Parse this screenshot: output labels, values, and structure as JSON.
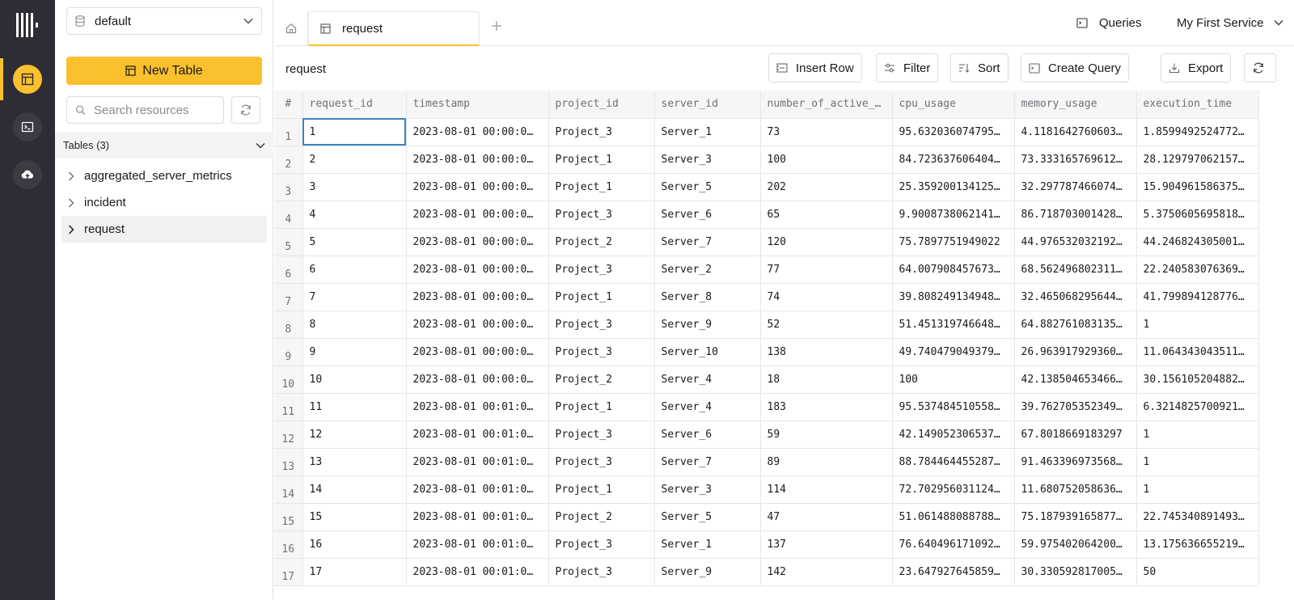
{
  "sidebar": {
    "database": "default",
    "new_table_label": "New Table",
    "search_placeholder": "Search resources",
    "tables_header": "Tables (3)",
    "tables": [
      {
        "name": "aggregated_server_metrics",
        "selected": false
      },
      {
        "name": "incident",
        "selected": false
      },
      {
        "name": "request",
        "selected": true
      }
    ]
  },
  "tabs": {
    "active_label": "request"
  },
  "header": {
    "queries_label": "Queries",
    "service_label": "My First Service"
  },
  "toolbar": {
    "table_title": "request",
    "insert_row_label": "Insert Row",
    "filter_label": "Filter",
    "sort_label": "Sort",
    "create_query_label": "Create Query",
    "export_label": "Export"
  },
  "grid": {
    "row_number_header": "#",
    "columns": [
      "request_id",
      "timestamp",
      "project_id",
      "server_id",
      "number_of_active_…",
      "cpu_usage",
      "memory_usage",
      "execution_time"
    ],
    "rows": [
      [
        "1",
        "2023-08-01 00:00:0…",
        "Project_3",
        "Server_1",
        "73",
        "95.632036074795…",
        "4.1181642760603…",
        "1.8599492524772…"
      ],
      [
        "2",
        "2023-08-01 00:00:0…",
        "Project_1",
        "Server_3",
        "100",
        "84.723637606404…",
        "73.333165769612…",
        "28.129797062157…"
      ],
      [
        "3",
        "2023-08-01 00:00:0…",
        "Project_1",
        "Server_5",
        "202",
        "25.359200134125…",
        "32.297787466074…",
        "15.904961586375…"
      ],
      [
        "4",
        "2023-08-01 00:00:0…",
        "Project_3",
        "Server_6",
        "65",
        "9.9008738062141…",
        "86.718703001428…",
        "5.3750605695818…"
      ],
      [
        "5",
        "2023-08-01 00:00:0…",
        "Project_2",
        "Server_7",
        "120",
        "75.7897751949022",
        "44.976532032192…",
        "44.246824305001…"
      ],
      [
        "6",
        "2023-08-01 00:00:0…",
        "Project_3",
        "Server_2",
        "77",
        "64.007908457673…",
        "68.562496802311…",
        "22.240583076369…"
      ],
      [
        "7",
        "2023-08-01 00:00:0…",
        "Project_1",
        "Server_8",
        "74",
        "39.808249134948…",
        "32.465068295644…",
        "41.799894128776…"
      ],
      [
        "8",
        "2023-08-01 00:00:0…",
        "Project_3",
        "Server_9",
        "52",
        "51.451319746648…",
        "64.882761083135…",
        "1"
      ],
      [
        "9",
        "2023-08-01 00:00:0…",
        "Project_3",
        "Server_10",
        "138",
        "49.740479049379…",
        "26.963917929360…",
        "11.064343043511…"
      ],
      [
        "10",
        "2023-08-01 00:00:0…",
        "Project_2",
        "Server_4",
        "18",
        "100",
        "42.138504653466…",
        "30.156105204882…"
      ],
      [
        "11",
        "2023-08-01 00:01:0…",
        "Project_1",
        "Server_4",
        "183",
        "95.537484510558…",
        "39.762705352349…",
        "6.3214825700921…"
      ],
      [
        "12",
        "2023-08-01 00:01:0…",
        "Project_3",
        "Server_6",
        "59",
        "42.149052306537…",
        "67.8018669183297",
        "1"
      ],
      [
        "13",
        "2023-08-01 00:01:0…",
        "Project_3",
        "Server_7",
        "89",
        "88.784464455287…",
        "91.463396973568…",
        "1"
      ],
      [
        "14",
        "2023-08-01 00:01:0…",
        "Project_1",
        "Server_3",
        "114",
        "72.702956031124…",
        "11.680752058636…",
        "1"
      ],
      [
        "15",
        "2023-08-01 00:01:0…",
        "Project_2",
        "Server_5",
        "47",
        "51.061488088788…",
        "75.187939165877…",
        "22.745340891493…"
      ],
      [
        "16",
        "2023-08-01 00:01:0…",
        "Project_3",
        "Server_1",
        "137",
        "76.640496171092…",
        "59.975402064200…",
        "13.175636655219…"
      ],
      [
        "17",
        "2023-08-01 00:01:0…",
        "Project_3",
        "Server_9",
        "142",
        "23.647927645859…",
        "30.330592817005…",
        "50"
      ]
    ]
  },
  "colors": {
    "accent": "#fbc02d",
    "rail_bg": "#2e2d35",
    "selection": "#3b82c4"
  },
  "icons": {
    "logo": "logo-icon",
    "rail": [
      "tables-icon",
      "terminal-icon",
      "cloud-upload-icon"
    ],
    "database": "database-icon",
    "search": "search-icon",
    "refresh": "refresh-icon"
  }
}
